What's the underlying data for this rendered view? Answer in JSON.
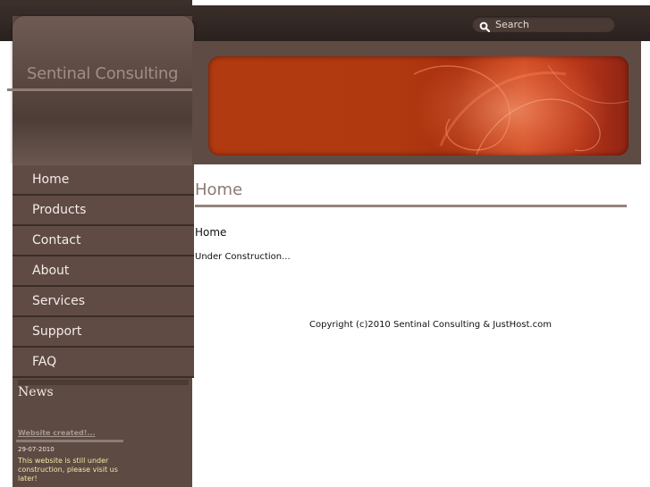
{
  "header": {
    "search": {
      "placeholder": "Search",
      "icon": "search-icon"
    }
  },
  "sidebar": {
    "site_title": "Sentinal Consulting",
    "nav": [
      {
        "label": "Home"
      },
      {
        "label": "Products"
      },
      {
        "label": "Contact"
      },
      {
        "label": "About"
      },
      {
        "label": "Services"
      },
      {
        "label": "Support"
      },
      {
        "label": "FAQ"
      }
    ],
    "news": {
      "heading": "News",
      "link": "Website created!...",
      "date": "29-07-2010",
      "text": "This website is still under construction, please visit us later!"
    }
  },
  "main": {
    "heading": "Home",
    "title": "Home",
    "body": "Under Construction...",
    "copyright": "Copyright (c)2010 Sentinal Consulting & JustHost.com"
  },
  "colors": {
    "sidebar_bg": "#5f4b44",
    "topbar_bg": "#2a211e",
    "banner": "#b23a10",
    "news_text": "#f3e7a8",
    "heading": "#8a7a73"
  }
}
